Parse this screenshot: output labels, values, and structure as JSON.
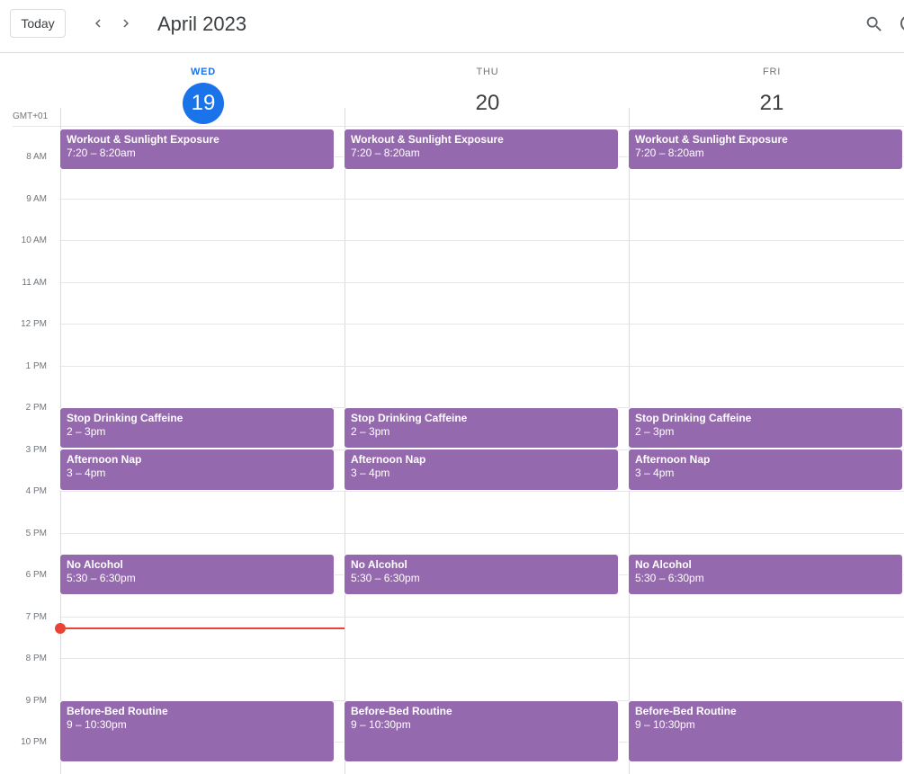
{
  "header": {
    "today_label": "Today",
    "prev_icon": "chevron-left-icon",
    "next_icon": "chevron-right-icon",
    "title": "April 2023",
    "search_icon": "search-icon"
  },
  "timezone": "GMT+01",
  "days": [
    {
      "name": "WED",
      "number": "19",
      "is_today": true
    },
    {
      "name": "THU",
      "number": "20",
      "is_today": false
    },
    {
      "name": "FRI",
      "number": "21",
      "is_today": false
    }
  ],
  "hours": [
    "8 AM",
    "9 AM",
    "10 AM",
    "11 AM",
    "12 PM",
    "1 PM",
    "2 PM",
    "3 PM",
    "4 PM",
    "5 PM",
    "6 PM",
    "7 PM",
    "8 PM",
    "9 PM",
    "10 PM"
  ],
  "events": {
    "day0": [
      {
        "title": "Workout & Sunlight Exposure",
        "time": "7:20 – 8:20am"
      },
      {
        "title": "Stop Drinking Caffeine",
        "time": "2 – 3pm"
      },
      {
        "title": "Afternoon Nap",
        "time": "3 – 4pm"
      },
      {
        "title": "No Alcohol",
        "time": "5:30 – 6:30pm"
      },
      {
        "title": "Before-Bed Routine",
        "time": "9 – 10:30pm"
      }
    ],
    "day1": [
      {
        "title": "Workout & Sunlight Exposure",
        "time": "7:20 – 8:20am"
      },
      {
        "title": "Stop Drinking Caffeine",
        "time": "2 – 3pm"
      },
      {
        "title": "Afternoon Nap",
        "time": "3 – 4pm"
      },
      {
        "title": "No Alcohol",
        "time": "5:30 – 6:30pm"
      },
      {
        "title": "Before-Bed Routine",
        "time": "9 – 10:30pm"
      }
    ],
    "day2": [
      {
        "title": "Workout & Sunlight Exposure",
        "time": "7:20 – 8:20am"
      },
      {
        "title": "Stop Drinking Caffeine",
        "time": "2 – 3pm"
      },
      {
        "title": "Afternoon Nap",
        "time": "3 – 4pm"
      },
      {
        "title": "No Alcohol",
        "time": "5:30 – 6:30pm"
      },
      {
        "title": "Before-Bed Routine",
        "time": "9 – 10:30pm"
      }
    ]
  },
  "colors": {
    "event": "#9569ad",
    "today_accent": "#1a73e8",
    "now_indicator": "#ea4335"
  }
}
